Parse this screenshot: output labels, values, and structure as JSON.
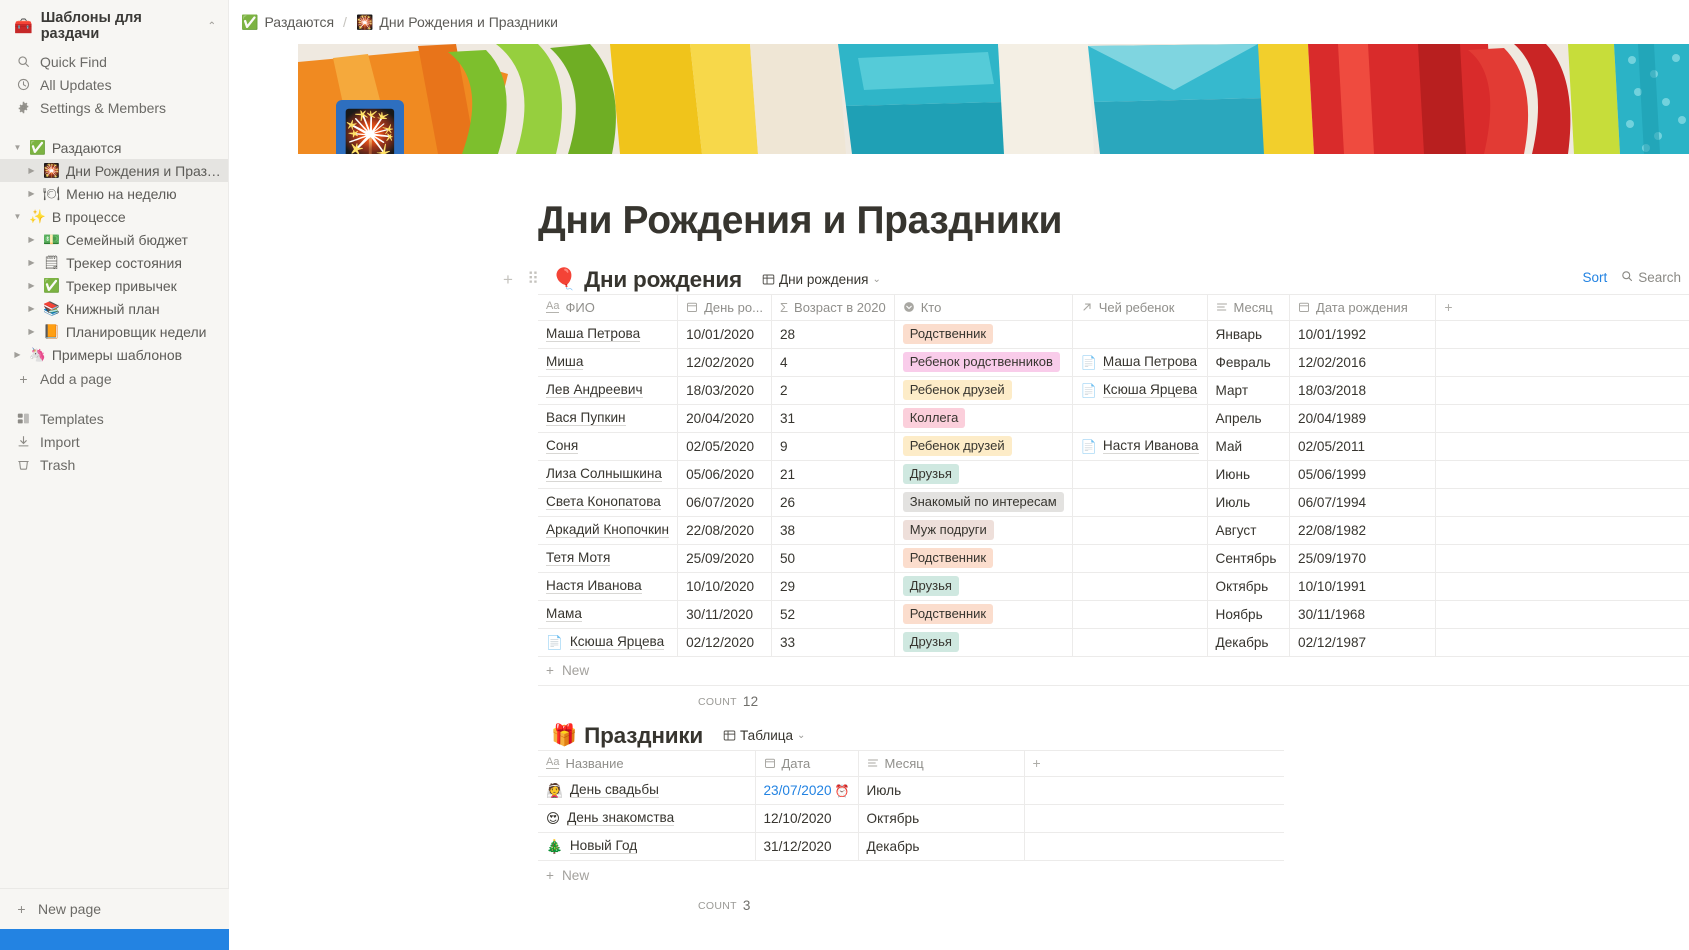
{
  "sidebar": {
    "workspace": {
      "emoji": "🧰",
      "name": "Шаблоны для раздачи",
      "caret": "⌃⌄"
    },
    "nav": [
      {
        "icon": "search-icon",
        "glyph": "🔍",
        "label": "Quick Find"
      },
      {
        "icon": "clock-icon",
        "glyph": "🕐",
        "label": "All Updates"
      },
      {
        "icon": "gear-icon",
        "glyph": "⚙",
        "label": "Settings & Members"
      }
    ],
    "tree": [
      {
        "level": 0,
        "twisty": "▼",
        "emoji": "✅",
        "label": "Раздаются",
        "selected": false
      },
      {
        "level": 1,
        "twisty": "▶",
        "emoji": "🎇",
        "label": "Дни Рождения и Праздн...",
        "selected": true
      },
      {
        "level": 1,
        "twisty": "▶",
        "emoji": "🍽",
        "label": "Меню на неделю",
        "selected": false
      },
      {
        "level": 0,
        "twisty": "▼",
        "emoji": "✨",
        "label": "В процессе",
        "selected": false
      },
      {
        "level": 1,
        "twisty": "▶",
        "emoji": "💵",
        "label": "Семейный бюджет",
        "selected": false
      },
      {
        "level": 1,
        "twisty": "▶",
        "emoji": "🗒",
        "label": "Трекер состояния",
        "selected": false
      },
      {
        "level": 1,
        "twisty": "▶",
        "emoji": "✅",
        "label": "Трекер привычек",
        "selected": false
      },
      {
        "level": 1,
        "twisty": "▶",
        "emoji": "📚",
        "label": "Книжный план",
        "selected": false
      },
      {
        "level": 1,
        "twisty": "▶",
        "emoji": "📙",
        "label": "Планировщик недели",
        "selected": false
      },
      {
        "level": 0,
        "twisty": "▶",
        "emoji": "🦄",
        "label": "Примеры шаблонов",
        "selected": false
      }
    ],
    "add_page": {
      "glyph": "+",
      "label": "Add a page"
    },
    "bottom_nav": [
      {
        "icon": "templates-icon",
        "glyph": "🗂",
        "label": "Templates"
      },
      {
        "icon": "import-icon",
        "glyph": "⤓",
        "label": "Import"
      },
      {
        "icon": "trash-icon",
        "glyph": "🗑",
        "label": "Trash"
      }
    ],
    "new_page": {
      "glyph": "+",
      "label": "New page"
    }
  },
  "breadcrumb": {
    "parent": {
      "emoji": "✅",
      "label": "Раздаются"
    },
    "separator": "/",
    "current": {
      "emoji": "🎇",
      "label": "Дни Рождения и Праздники"
    }
  },
  "page": {
    "icon_emoji": "🎇",
    "title": "Дни Рождения и Праздники"
  },
  "birthdays": {
    "emoji": "🎈",
    "title": "Дни рождения",
    "view": {
      "icon": "table-view-icon",
      "label": "Дни рождения",
      "caret": "⌄"
    },
    "tools": {
      "sort": "Sort",
      "search": "Search",
      "search_icon": "🔍"
    },
    "columns": [
      {
        "icon": "text-type-icon",
        "glyph": "Aa",
        "label": "ФИО"
      },
      {
        "icon": "date-type-icon",
        "glyph": "▤",
        "label": "День ро..."
      },
      {
        "icon": "formula-type-icon",
        "glyph": "Σ",
        "label": "Возраст в 2020"
      },
      {
        "icon": "select-type-icon",
        "glyph": "◉",
        "label": "Кто"
      },
      {
        "icon": "relation-type-icon",
        "glyph": "↗",
        "label": "Чей ребенок"
      },
      {
        "icon": "text-lines-icon",
        "glyph": "≡",
        "label": "Месяц"
      },
      {
        "icon": "date-type-icon",
        "glyph": "▤",
        "label": "Дата рождения"
      },
      {
        "icon": "add-column-icon",
        "glyph": "+",
        "label": ""
      }
    ],
    "rows": [
      {
        "emoji": "",
        "name": "Маша Петрова",
        "day": "10/01/2020",
        "age": "28",
        "tag": "Родственник",
        "tag_bg": "#fbddcd",
        "rel": "",
        "rel_icon": "",
        "month": "Январь",
        "birth": "10/01/1992"
      },
      {
        "emoji": "",
        "name": "Миша",
        "day": "12/02/2020",
        "age": "4",
        "tag": "Ребенок родственников",
        "tag_bg": "#f9ccea",
        "rel": "Маша Петрова",
        "rel_icon": "📄",
        "month": "Февраль",
        "birth": "12/02/2016"
      },
      {
        "emoji": "",
        "name": "Лев Андреевич",
        "day": "18/03/2020",
        "age": "2",
        "tag": "Ребенок друзей",
        "tag_bg": "#fdecc8",
        "rel": "Ксюша Ярцева",
        "rel_icon": "📄",
        "month": "Март",
        "birth": "18/03/2018"
      },
      {
        "emoji": "",
        "name": "Вася Пупкин",
        "day": "20/04/2020",
        "age": "31",
        "tag": "Коллега",
        "tag_bg": "#fbcfdb",
        "rel": "",
        "rel_icon": "",
        "month": "Апрель",
        "birth": "20/04/1989"
      },
      {
        "emoji": "",
        "name": "Соня",
        "day": "02/05/2020",
        "age": "9",
        "tag": "Ребенок друзей",
        "tag_bg": "#fdecc8",
        "rel": "Настя Иванова",
        "rel_icon": "📄",
        "month": "Май",
        "birth": "02/05/2011"
      },
      {
        "emoji": "",
        "name": "Лиза Солнышкина",
        "day": "05/06/2020",
        "age": "21",
        "tag": "Друзья",
        "tag_bg": "#cfe8e0",
        "rel": "",
        "rel_icon": "",
        "month": "Июнь",
        "birth": "05/06/1999"
      },
      {
        "emoji": "",
        "name": "Света Конопатова",
        "day": "06/07/2020",
        "age": "26",
        "tag": "Знакомый по интересам",
        "tag_bg": "#e3e2e0",
        "rel": "",
        "rel_icon": "",
        "month": "Июль",
        "birth": "06/07/1994"
      },
      {
        "emoji": "",
        "name": "Аркадий Кнопочкин",
        "day": "22/08/2020",
        "age": "38",
        "tag": "Муж подруги",
        "tag_bg": "#eedfda",
        "rel": "",
        "rel_icon": "",
        "month": "Август",
        "birth": "22/08/1982"
      },
      {
        "emoji": "",
        "name": "Тетя Мотя",
        "day": "25/09/2020",
        "age": "50",
        "tag": "Родственник",
        "tag_bg": "#fbddcd",
        "rel": "",
        "rel_icon": "",
        "month": "Сентябрь",
        "birth": "25/09/1970"
      },
      {
        "emoji": "",
        "name": "Настя Иванова",
        "day": "10/10/2020",
        "age": "29",
        "tag": "Друзья",
        "tag_bg": "#cfe8e0",
        "rel": "",
        "rel_icon": "",
        "month": "Октябрь",
        "birth": "10/10/1991"
      },
      {
        "emoji": "",
        "name": "Мама",
        "day": "30/11/2020",
        "age": "52",
        "tag": "Родственник",
        "tag_bg": "#fbddcd",
        "rel": "",
        "rel_icon": "",
        "month": "Ноябрь",
        "birth": "30/11/1968"
      },
      {
        "emoji": "📄",
        "name": "Ксюша Ярцева",
        "day": "02/12/2020",
        "age": "33",
        "tag": "Друзья",
        "tag_bg": "#cfe8e0",
        "rel": "",
        "rel_icon": "",
        "month": "Декабрь",
        "birth": "02/12/1987"
      }
    ],
    "new_label": "New",
    "new_glyph": "+",
    "count_label": "COUNT",
    "count_value": "12"
  },
  "holidays": {
    "emoji": "🎁",
    "title": "Праздники",
    "view": {
      "icon": "table-view-icon",
      "label": "Таблица",
      "caret": "⌄"
    },
    "columns": [
      {
        "icon": "text-type-icon",
        "glyph": "Aa",
        "label": "Название"
      },
      {
        "icon": "date-type-icon",
        "glyph": "▤",
        "label": "Дата"
      },
      {
        "icon": "text-lines-icon",
        "glyph": "≡",
        "label": "Месяц"
      },
      {
        "icon": "add-column-icon",
        "glyph": "+",
        "label": ""
      }
    ],
    "rows": [
      {
        "emoji": "👰",
        "name": "День свадьбы",
        "date": "23/07/2020",
        "reminder": "⏰",
        "date_link": true,
        "month": "Июль"
      },
      {
        "emoji": "😍",
        "name": "День знакомства",
        "date": "12/10/2020",
        "reminder": "",
        "date_link": false,
        "month": "Октябрь"
      },
      {
        "emoji": "🎄",
        "name": "Новый Год",
        "date": "31/12/2020",
        "reminder": "",
        "date_link": false,
        "month": "Декабрь"
      }
    ],
    "new_label": "New",
    "new_glyph": "+",
    "count_label": "COUNT",
    "count_value": "3"
  },
  "colors": {
    "accent_blue": "#2383e2",
    "sidebar_bg": "#f7f6f3",
    "text": "#37352f"
  }
}
